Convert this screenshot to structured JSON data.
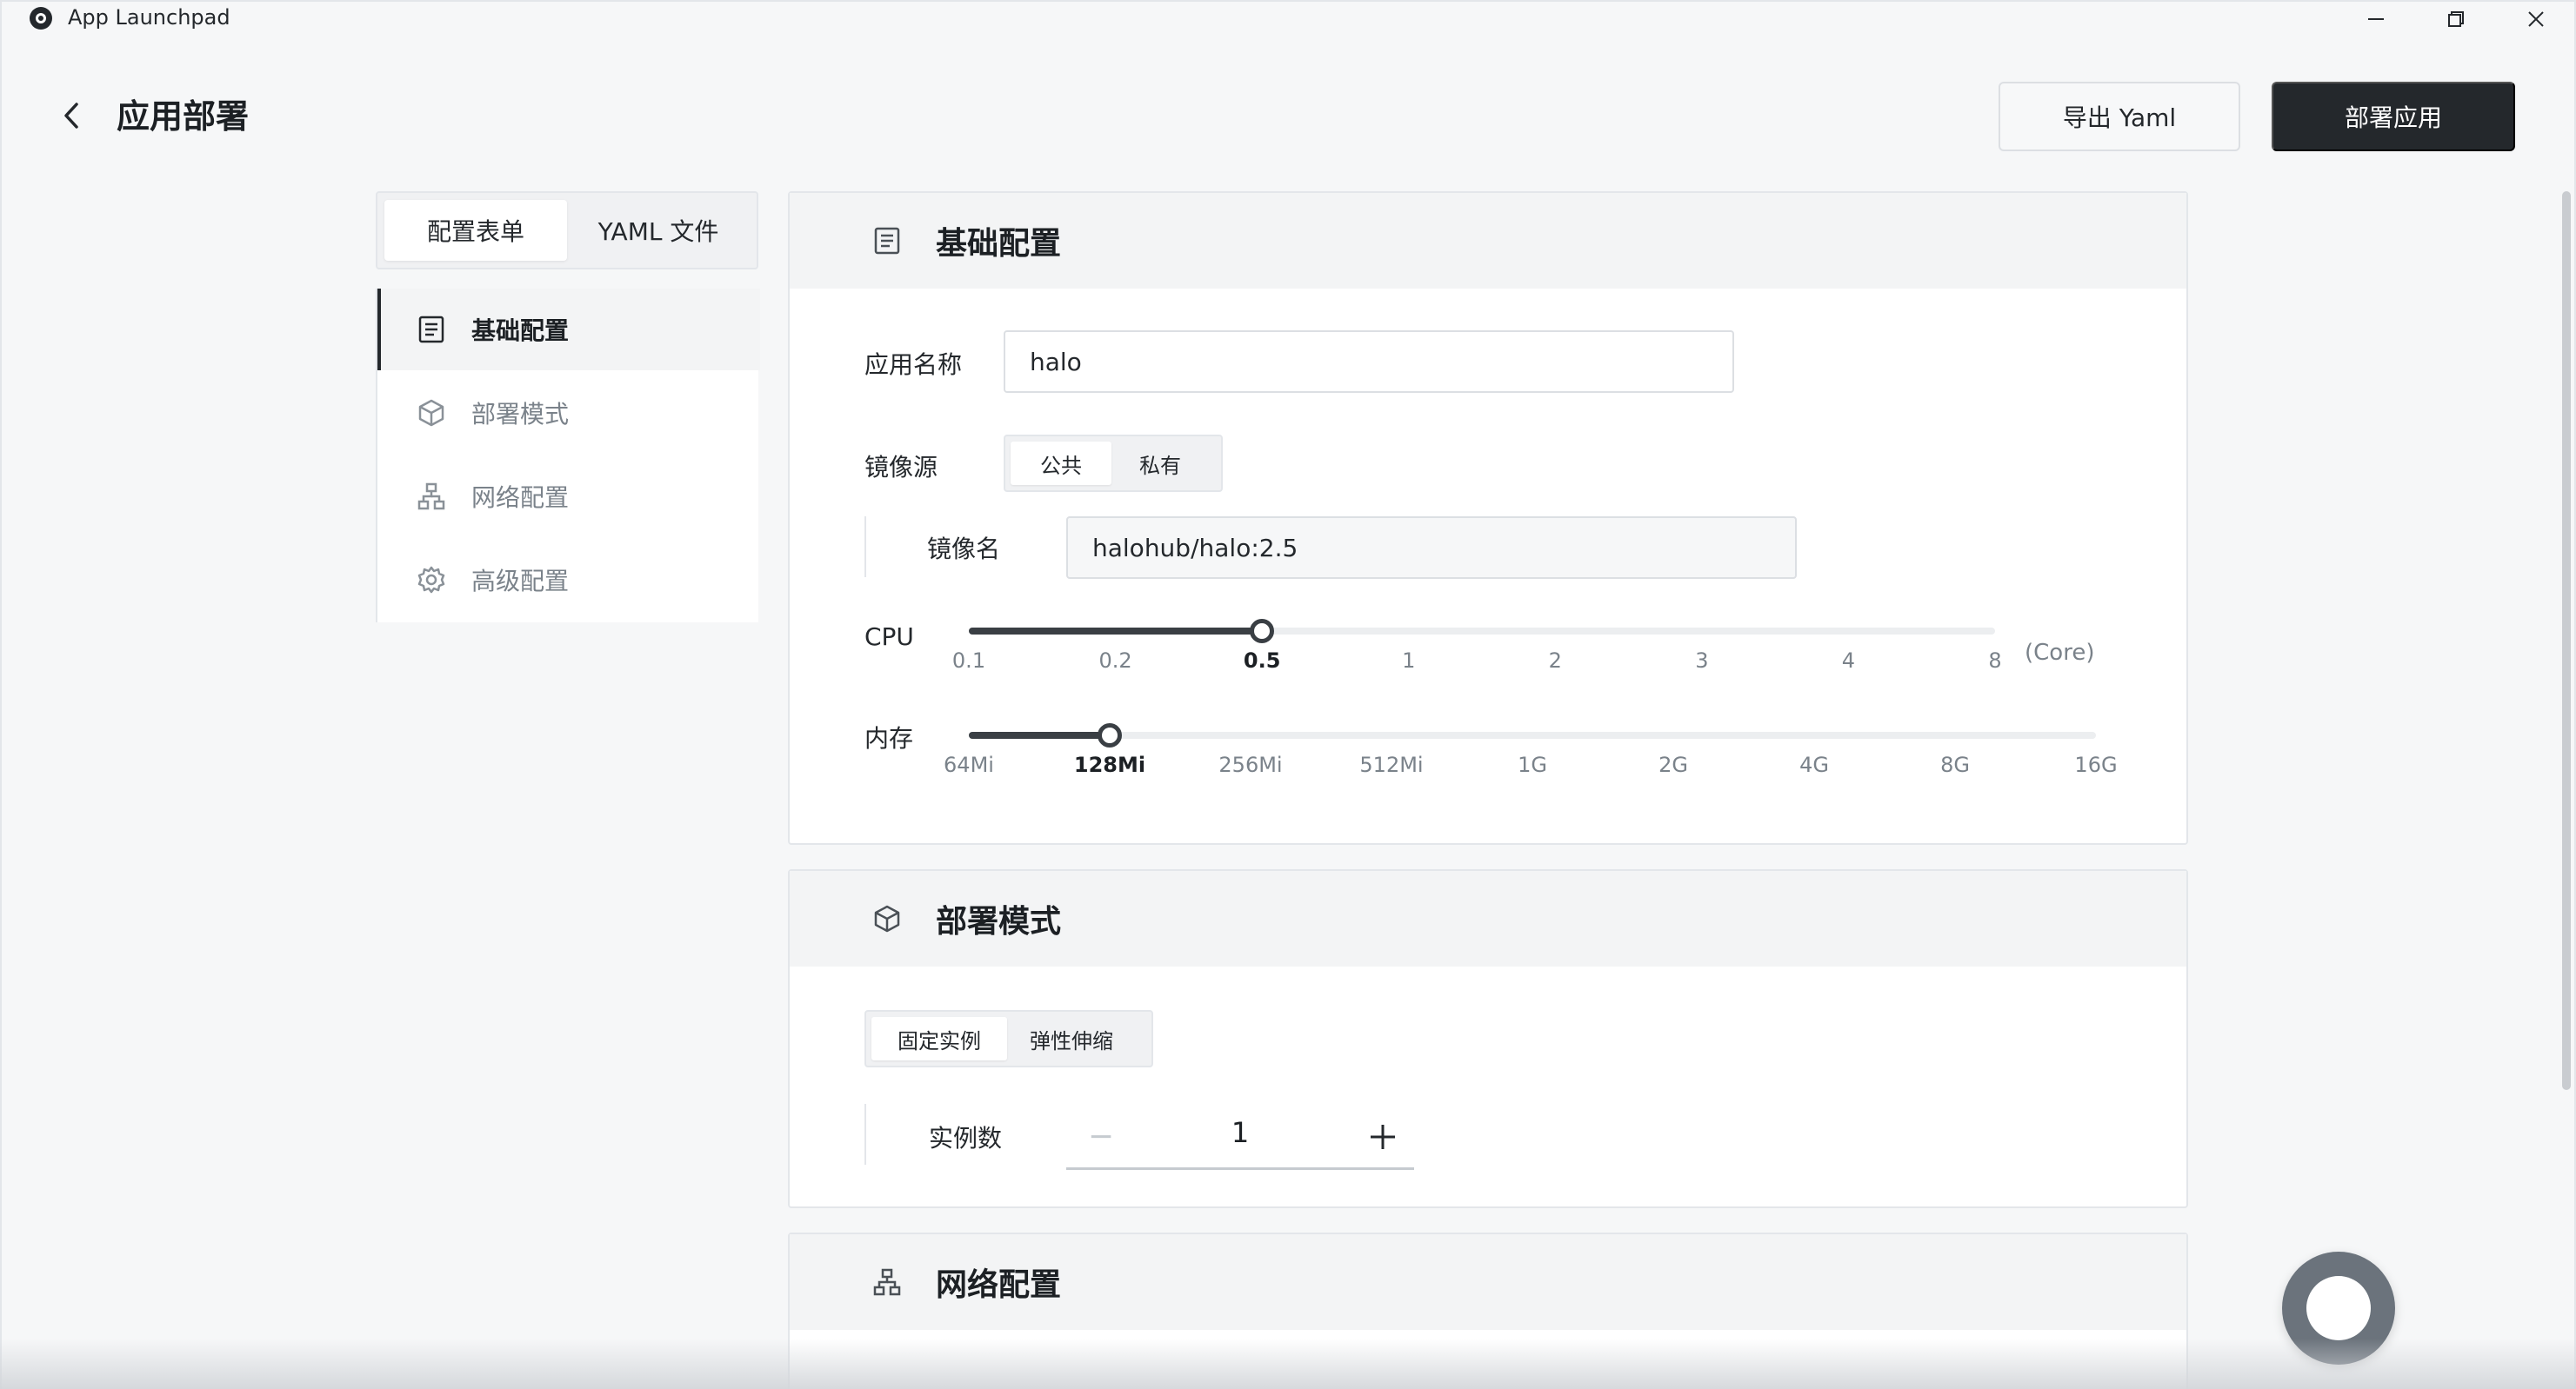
{
  "window": {
    "title": "App Launchpad"
  },
  "header": {
    "title": "应用部署",
    "export_label": "导出 Yaml",
    "deploy_label": "部署应用"
  },
  "sidebar": {
    "tabs": [
      {
        "label": "配置表单",
        "active": true
      },
      {
        "label": "YAML 文件",
        "active": false
      }
    ],
    "items": [
      {
        "label": "基础配置",
        "icon": "form-icon",
        "active": true
      },
      {
        "label": "部署模式",
        "icon": "cube-icon",
        "active": false
      },
      {
        "label": "网络配置",
        "icon": "network-icon",
        "active": false
      },
      {
        "label": "高级配置",
        "icon": "gear-icon",
        "active": false
      }
    ]
  },
  "basic": {
    "title": "基础配置",
    "app_name_label": "应用名称",
    "app_name_value": "halo",
    "image_source_label": "镜像源",
    "image_source_options": [
      {
        "label": "公共",
        "active": true
      },
      {
        "label": "私有",
        "active": false
      }
    ],
    "image_name_label": "镜像名",
    "image_name_value": "halohub/halo:2.5",
    "cpu": {
      "label": "CPU",
      "ticks": [
        "0.1",
        "0.2",
        "0.5",
        "1",
        "2",
        "3",
        "4",
        "8"
      ],
      "selected": "0.5",
      "unit": "(Core)"
    },
    "memory": {
      "label": "内存",
      "ticks": [
        "64Mi",
        "128Mi",
        "256Mi",
        "512Mi",
        "1G",
        "2G",
        "4G",
        "8G",
        "16G"
      ],
      "selected": "128Mi"
    }
  },
  "deploy_mode": {
    "title": "部署模式",
    "options": [
      {
        "label": "固定实例",
        "active": true
      },
      {
        "label": "弹性伸缩",
        "active": false
      }
    ],
    "replicas_label": "实例数",
    "replicas_value": "1"
  },
  "network": {
    "title": "网络配置"
  },
  "colors": {
    "primary": "#24282c",
    "border": "#e3e6ea",
    "muted": "#7a828a",
    "background": "#f6f7f8"
  }
}
